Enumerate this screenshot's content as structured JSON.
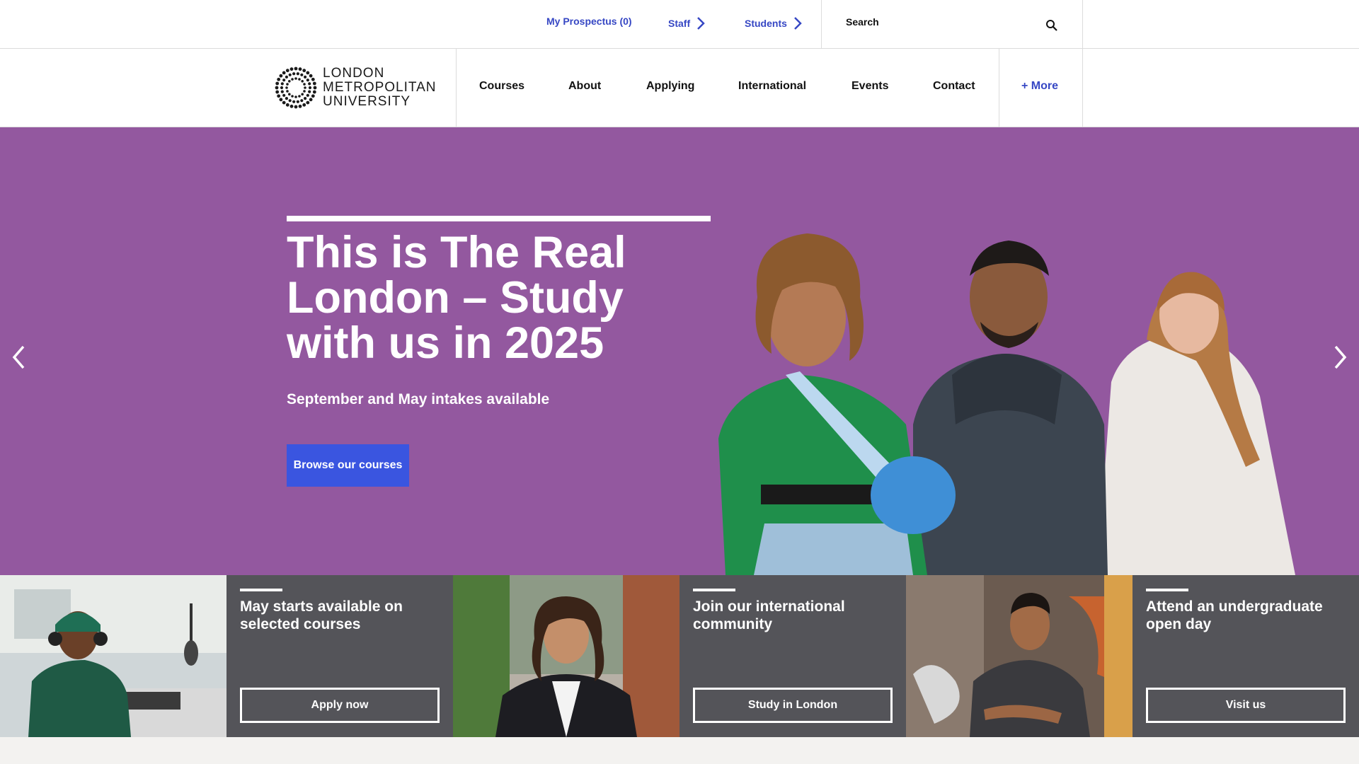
{
  "utility_bar": {
    "prospectus_label": "My Prospectus (0)",
    "staff_label": "Staff",
    "students_label": "Students",
    "search_placeholder": "Search"
  },
  "logo": {
    "line1": "London",
    "line2": "Metropolitan",
    "line3": "University"
  },
  "nav": {
    "items": [
      "Courses",
      "About",
      "Applying",
      "International",
      "Events",
      "Contact"
    ],
    "more_label": "+ More"
  },
  "hero": {
    "title": "This is The Real London – Study with us in 2025",
    "subtitle": "September and May intakes available",
    "cta_label": "Browse our courses",
    "background_color": "#93589f"
  },
  "promos": [
    {
      "title": "May starts available on selected courses",
      "button": "Apply now"
    },
    {
      "title": "Join our international community",
      "button": "Study in London"
    },
    {
      "title": "Attend an undergraduate open day",
      "button": "Visit us"
    }
  ],
  "colors": {
    "accent_link": "#3647c4",
    "cta_blue": "#3a55e0",
    "promo_card": "#545459"
  }
}
